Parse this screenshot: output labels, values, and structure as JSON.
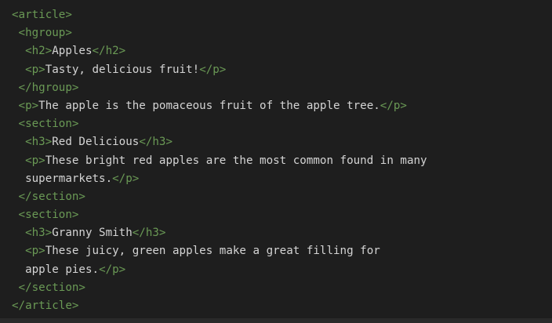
{
  "code_lines": [
    {
      "indent": "",
      "open": "<article>",
      "text": "",
      "close": ""
    },
    {
      "indent": " ",
      "open": "<hgroup>",
      "text": "",
      "close": ""
    },
    {
      "indent": "  ",
      "open": "<h2>",
      "text": "Apples",
      "close": "</h2>"
    },
    {
      "indent": "  ",
      "open": "<p>",
      "text": "Tasty, delicious fruit!",
      "close": "</p>"
    },
    {
      "indent": " ",
      "open": "</hgroup>",
      "text": "",
      "close": ""
    },
    {
      "indent": " ",
      "open": "<p>",
      "text": "The apple is the pomaceous fruit of the apple tree.",
      "close": "</p>"
    },
    {
      "indent": " ",
      "open": "<section>",
      "text": "",
      "close": ""
    },
    {
      "indent": "  ",
      "open": "<h3>",
      "text": "Red Delicious",
      "close": "</h3>"
    },
    {
      "indent": "  ",
      "open": "<p>",
      "text": "These bright red apples are the most common found in many",
      "close": ""
    },
    {
      "indent": "  ",
      "open": "",
      "text": "supermarkets.",
      "close": "</p>"
    },
    {
      "indent": " ",
      "open": "</section>",
      "text": "",
      "close": ""
    },
    {
      "indent": " ",
      "open": "<section>",
      "text": "",
      "close": ""
    },
    {
      "indent": "  ",
      "open": "<h3>",
      "text": "Granny Smith",
      "close": "</h3>"
    },
    {
      "indent": "  ",
      "open": "<p>",
      "text": "These juicy, green apples make a great filling for",
      "close": ""
    },
    {
      "indent": "  ",
      "open": "",
      "text": "apple pies.",
      "close": "</p>"
    },
    {
      "indent": " ",
      "open": "</section>",
      "text": "",
      "close": ""
    },
    {
      "indent": "",
      "open": "</article>",
      "text": "",
      "close": ""
    }
  ]
}
